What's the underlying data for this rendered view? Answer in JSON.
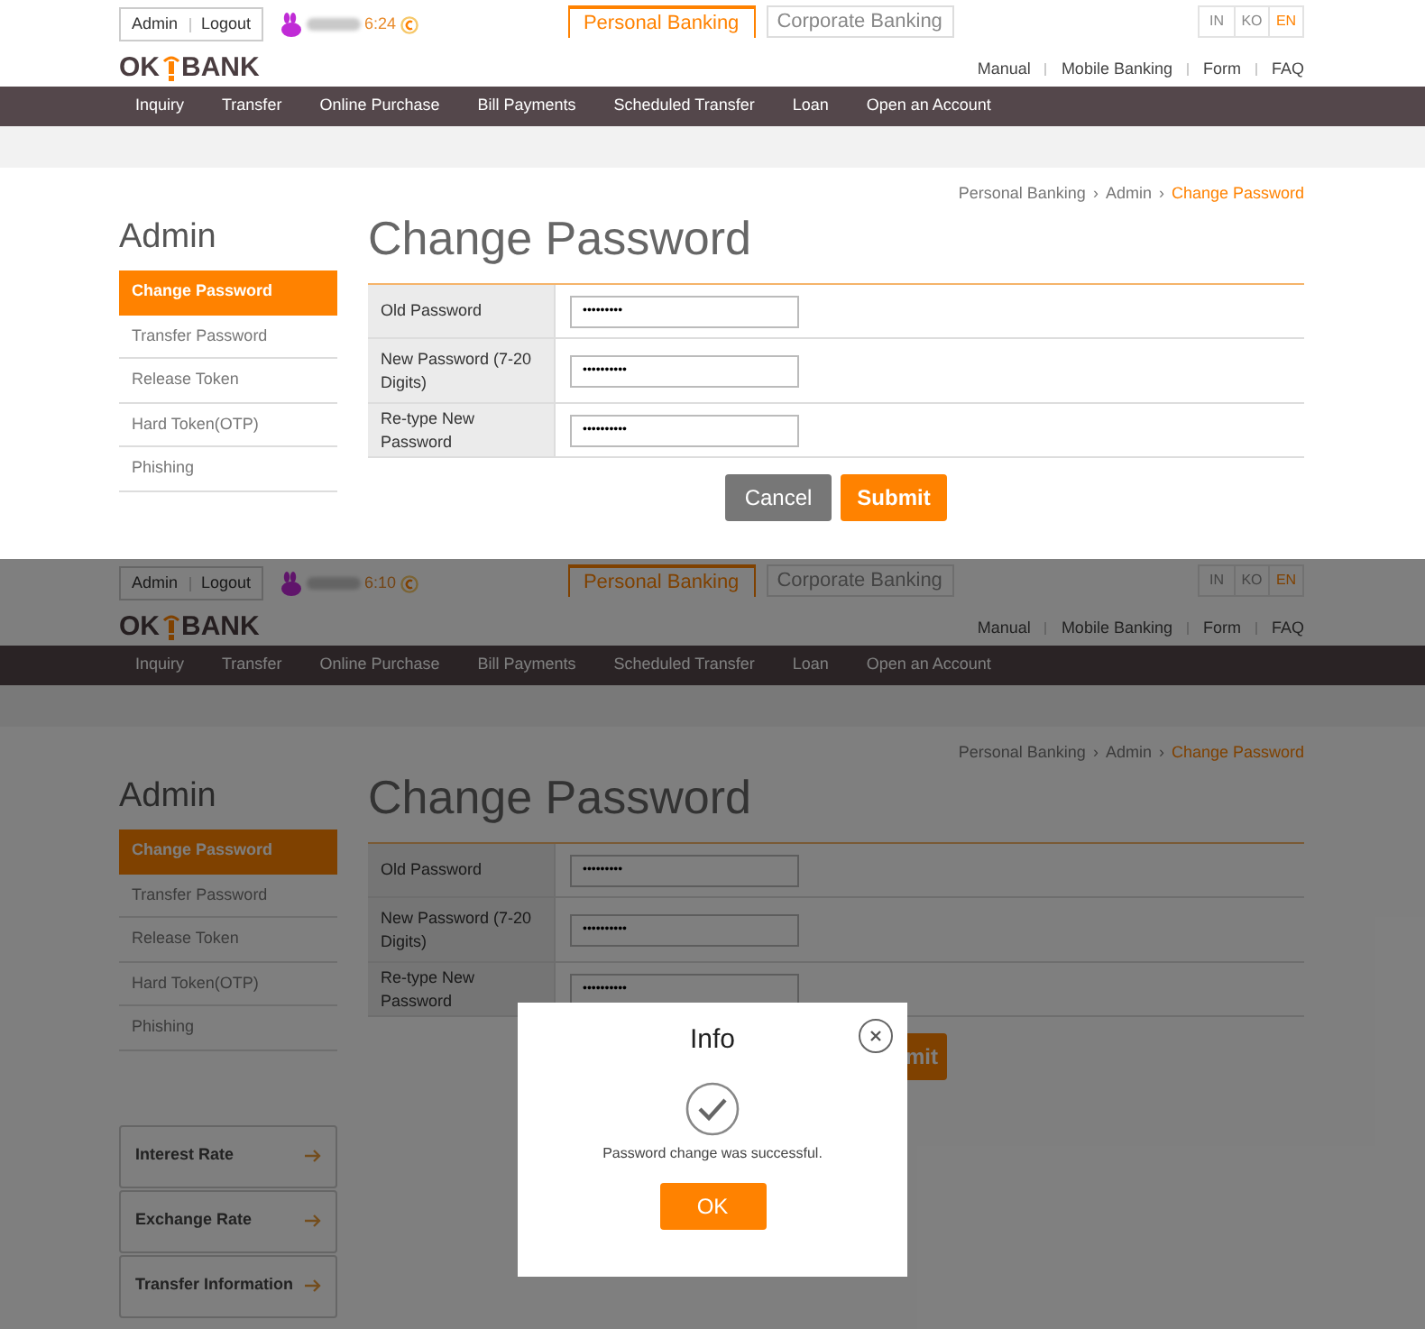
{
  "screens": [
    {
      "dimmed": false,
      "account": [
        "Admin",
        "Logout"
      ],
      "time": "6:24",
      "bank_tabs": [
        {
          "label": "Personal Banking",
          "selected": true
        },
        {
          "label": "Corporate Banking",
          "selected": false
        }
      ],
      "languages": [
        {
          "label": "IN",
          "selected": false
        },
        {
          "label": "KO",
          "selected": false
        },
        {
          "label": "EN",
          "selected": true
        }
      ],
      "logo": {
        "left": "OK",
        "right": "BANK"
      },
      "utility_links": [
        "Manual",
        "Mobile Banking",
        "Form",
        "FAQ"
      ],
      "nav": [
        "Inquiry",
        "Transfer",
        "Online Purchase",
        "Bill Payments",
        "Scheduled Transfer",
        "Loan",
        "Open an Account"
      ],
      "breadcrumb": [
        "Personal Banking",
        "Admin",
        "Change Password"
      ],
      "breadcrumb_separator": "›",
      "sidebar": {
        "title": "Admin",
        "items": [
          {
            "label": "Change Password",
            "selected": true
          },
          {
            "label": "Transfer Password",
            "selected": false
          },
          {
            "label": "Release Token",
            "selected": false
          },
          {
            "label": "Hard Token(OTP)",
            "selected": false
          },
          {
            "label": "Phishing",
            "selected": false
          }
        ]
      },
      "title": "Change Password",
      "form": [
        {
          "label": "Old Password",
          "value": "•••••••••"
        },
        {
          "label": "New Password (7-20 Digits)",
          "value": "••••••••••"
        },
        {
          "label": "Re-type New Password",
          "value": "••••••••••"
        }
      ],
      "buttons": [
        {
          "kind": "cancel",
          "label": "Cancel"
        },
        {
          "kind": "submit",
          "label": "Submit",
          "clipped": false
        }
      ]
    },
    {
      "dimmed": true,
      "account": [
        "Admin",
        "Logout"
      ],
      "time": "6:10",
      "bank_tabs": [
        {
          "label": "Personal Banking",
          "selected": true
        },
        {
          "label": "Corporate Banking",
          "selected": false
        }
      ],
      "languages": [
        {
          "label": "IN",
          "selected": false
        },
        {
          "label": "KO",
          "selected": false
        },
        {
          "label": "EN",
          "selected": true
        }
      ],
      "logo": {
        "left": "OK",
        "right": "BANK"
      },
      "utility_links": [
        "Manual",
        "Mobile Banking",
        "Form",
        "FAQ"
      ],
      "nav": [
        "Inquiry",
        "Transfer",
        "Online Purchase",
        "Bill Payments",
        "Scheduled Transfer",
        "Loan",
        "Open an Account"
      ],
      "breadcrumb": [
        "Personal Banking",
        "Admin",
        "Change Password"
      ],
      "breadcrumb_separator": "›",
      "sidebar": {
        "title": "Admin",
        "items": [
          {
            "label": "Change Password",
            "selected": true
          },
          {
            "label": "Transfer Password",
            "selected": false
          },
          {
            "label": "Release Token",
            "selected": false
          },
          {
            "label": "Hard Token(OTP)",
            "selected": false
          },
          {
            "label": "Phishing",
            "selected": false
          }
        ]
      },
      "title": "Change Password",
      "form": [
        {
          "label": "Old Password",
          "value": "•••••••••"
        },
        {
          "label": "New Password (7-20 Digits)",
          "value": "••••••••••"
        },
        {
          "label": "Re-type New Password",
          "value": "••••••••••"
        }
      ],
      "buttons": [
        {
          "kind": "submit",
          "label": "mit",
          "clipped": true
        }
      ],
      "quick_links": [
        "Interest Rate",
        "Exchange Rate",
        "Transfer Information"
      ],
      "dialog": {
        "title": "Info",
        "message": "Password change was successful.",
        "button": "OK"
      }
    }
  ]
}
